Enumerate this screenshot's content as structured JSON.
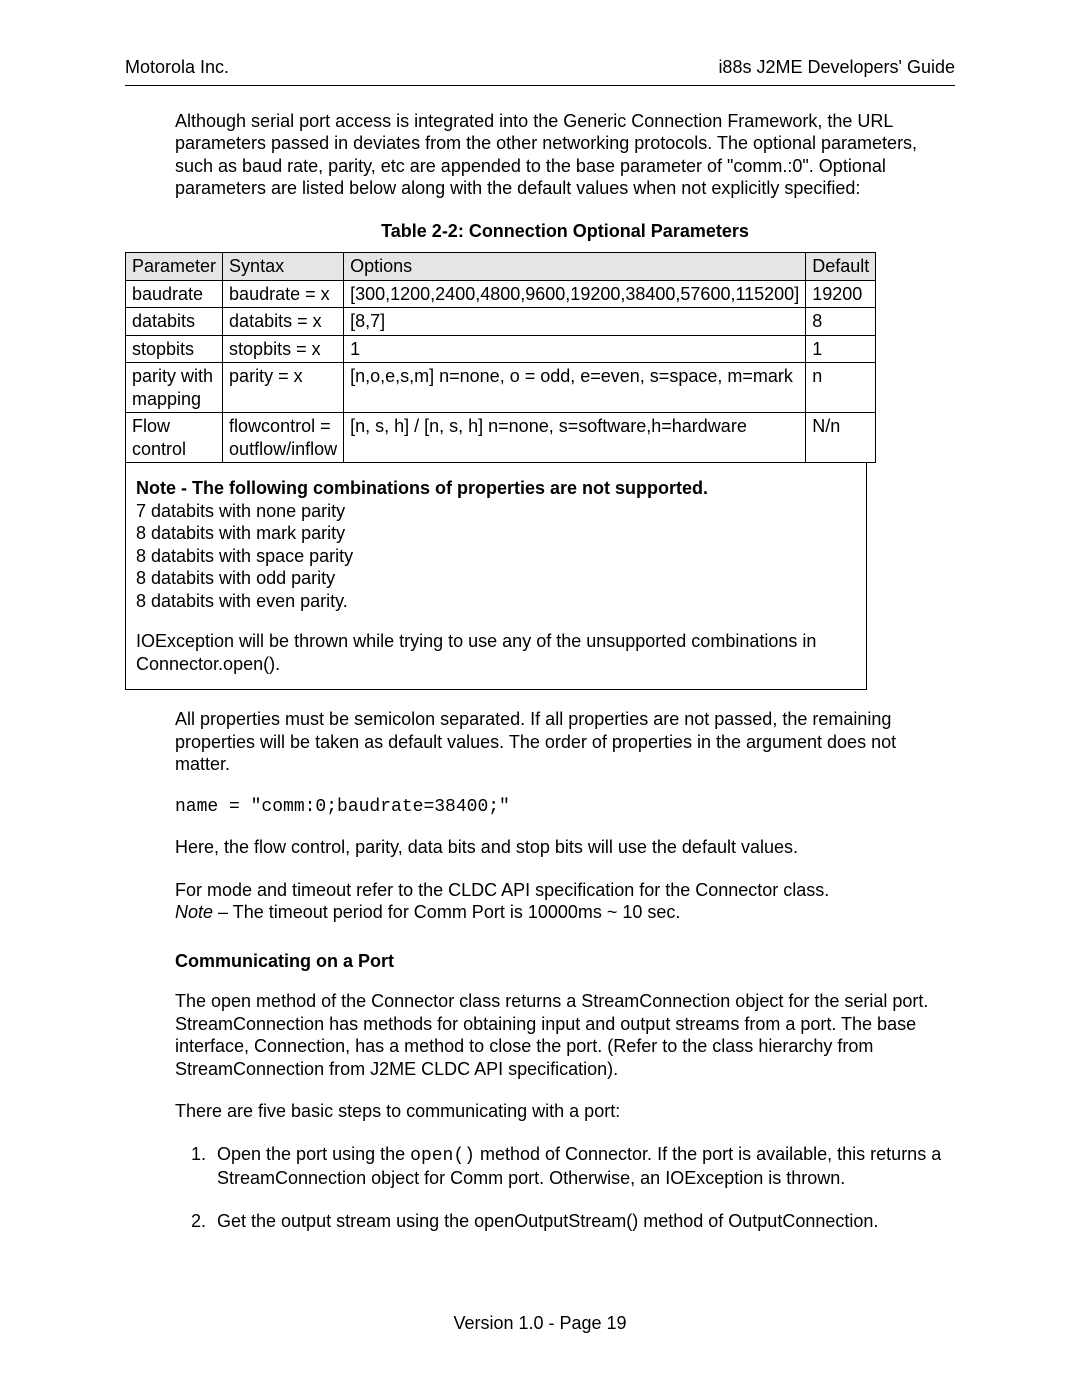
{
  "header": {
    "left": "Motorola Inc.",
    "right": "i88s J2ME Developers' Guide"
  },
  "paragraphs": {
    "intro": "Although serial port access is integrated into the Generic Connection Framework, the URL parameters passed in deviates from the other networking protocols.  The optional parameters, such as baud rate, parity, etc are appended to the base parameter of \"comm.:0\".  Optional parameters are listed below along with the default values when not explicitly specified:",
    "after_table": "All properties must be semicolon separated. If all properties are not passed, the remaining properties will be taken as default values. The order of properties in the argument does not matter.",
    "after_code": "Here, the flow control, parity, data bits and stop bits will use the default values.",
    "mode_timeout": "For mode and timeout refer to the CLDC API specification for the Connector class.",
    "note_prefix": "Note",
    "note_rest": " – The timeout period for Comm Port is 10000ms ~ 10 sec.",
    "comm_desc": "The open method of the Connector class returns a StreamConnection object for the serial port. StreamConnection has methods for obtaining input and output streams from a port. The base interface, Connection, has a method to close the port. (Refer to the class hierarchy from StreamConnection from J2ME CLDC API specification).",
    "five_steps": "There are five basic steps to communicating with a port:"
  },
  "table": {
    "caption": "Table 2-2: Connection Optional Parameters",
    "headers": [
      "Parameter",
      "Syntax",
      "Options",
      "Default"
    ],
    "rows": [
      {
        "param": "baudrate",
        "syntax": "baudrate = x",
        "options": "[300,1200,2400,4800,9600,19200,38400,57600,115200]",
        "default": "19200"
      },
      {
        "param": "databits",
        "syntax": "databits = x",
        "options": "[8,7]",
        "default": "8"
      },
      {
        "param": "stopbits",
        "syntax": "stopbits = x",
        "options": "1",
        "default": "1"
      },
      {
        "param": "parity with mapping",
        "syntax": "parity = x",
        "options": "[n,o,e,s,m]  n=none, o = odd, e=even, s=space, m=mark",
        "default": "n"
      },
      {
        "param": "Flow control",
        "syntax": "flowcontrol = outflow/inflow",
        "options": "[n, s, h] / [n, s, h] n=none, s=software,h=hardware",
        "default": "N/n"
      }
    ]
  },
  "note_box": {
    "title": "Note - The following combinations of properties are not supported.",
    "lines": [
      "7 databits with none parity",
      "8 databits with mark parity",
      "8 databits with space parity",
      "8 databits with odd parity",
      "8 databits with even parity."
    ],
    "exception": "IOException will be thrown while trying to use any of the unsupported combinations in Connector.open()."
  },
  "code": {
    "name_line": "name = \"comm:0;baudrate=38400;\""
  },
  "section": {
    "communicating": "Communicating on a Port"
  },
  "steps": {
    "s1a": "Open the port using the ",
    "s1code": "open()",
    "s1b": " method of Connector. If the port is available, this returns a StreamConnection object for Comm port. Otherwise, an IOException is thrown.",
    "s2": "Get the output stream using the openOutputStream() method of OutputConnection."
  },
  "footer": "Version 1.0 - Page 19"
}
